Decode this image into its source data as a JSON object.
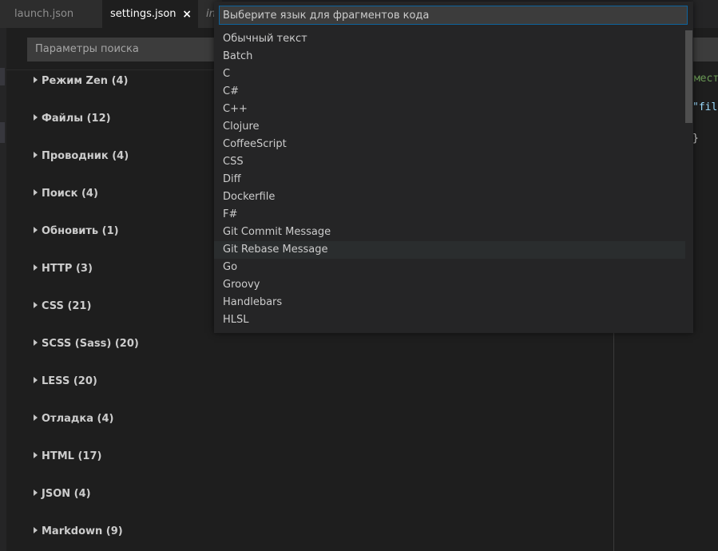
{
  "tabs": [
    {
      "label": "launch.json"
    },
    {
      "label": "settings.json",
      "close": "×"
    },
    {
      "label": "in"
    }
  ],
  "settings": {
    "search_placeholder": "Параметры поиска",
    "groups": [
      {
        "label": "Режим Zen (4)"
      },
      {
        "label": "Файлы (12)"
      },
      {
        "label": "Проводник (4)"
      },
      {
        "label": "Поиск (4)"
      },
      {
        "label": "Обновить (1)"
      },
      {
        "label": "HTTP (3)"
      },
      {
        "label": "CSS (21)"
      },
      {
        "label": "SCSS (Sass) (20)"
      },
      {
        "label": "LESS (20)"
      },
      {
        "label": "Отладка (4)"
      },
      {
        "label": "HTML (17)"
      },
      {
        "label": "JSON (4)"
      },
      {
        "label": "Markdown (9)"
      }
    ]
  },
  "editor": {
    "line1": "омест",
    "line2": "\"file",
    "line3": "}"
  },
  "quickpick": {
    "placeholder": "Выберите язык для фрагментов кода",
    "items": [
      {
        "label": "Обычный текст"
      },
      {
        "label": "Batch"
      },
      {
        "label": "C"
      },
      {
        "label": "C#"
      },
      {
        "label": "C++"
      },
      {
        "label": "Clojure"
      },
      {
        "label": "CoffeeScript"
      },
      {
        "label": "CSS"
      },
      {
        "label": "Diff"
      },
      {
        "label": "Dockerfile"
      },
      {
        "label": "F#"
      },
      {
        "label": "Git Commit Message"
      },
      {
        "label": "Git Rebase Message"
      },
      {
        "label": "Go"
      },
      {
        "label": "Groovy"
      },
      {
        "label": "Handlebars"
      },
      {
        "label": "HLSL"
      }
    ],
    "hovered_index": 12
  },
  "colors": {
    "accent_border": "#0e639c",
    "string_color": "#9cdcfe",
    "comment_color": "#6a9955"
  }
}
